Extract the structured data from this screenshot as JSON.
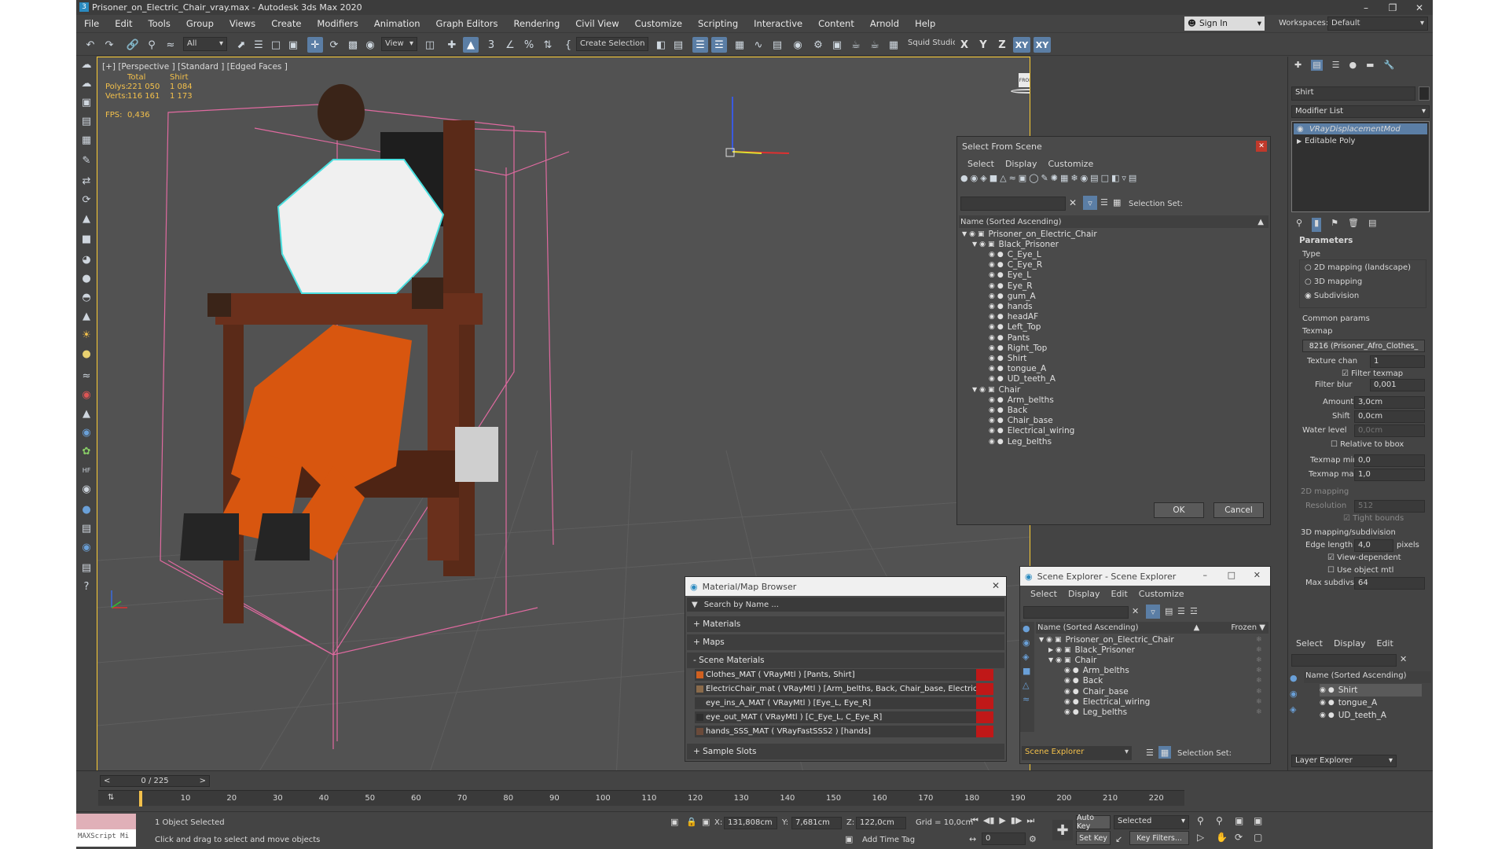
{
  "window": {
    "title": "Prisoner_on_Electric_Chair_vray.max - Autodesk 3ds Max 2020",
    "min": "–",
    "max": "❐",
    "close": "✕"
  },
  "menu": [
    "File",
    "Edit",
    "Tools",
    "Group",
    "Views",
    "Create",
    "Modifiers",
    "Animation",
    "Graph Editors",
    "Rendering",
    "Civil View",
    "Customize",
    "Scripting",
    "Interactive",
    "Content",
    "Arnold",
    "Help"
  ],
  "signin": {
    "label": "Sign In",
    "workspaces_label": "Workspaces:",
    "workspace": "Default"
  },
  "toolbar": {
    "filter_all": "All",
    "view": "View",
    "create_selection": "Create Selection Se",
    "squid": "Squid Studio v",
    "axes": [
      "X",
      "Y",
      "Z",
      "XY",
      "XY"
    ]
  },
  "viewport": {
    "label": "[+] [Perspective ] [Standard ] [Edged Faces ]",
    "stats": {
      "h_total": "Total",
      "h_obj": "Shirt",
      "polys_label": "Polys:",
      "polys_total": "221 050",
      "polys_obj": "1 084",
      "verts_label": "Verts:",
      "verts_total": "116 161",
      "verts_obj": "1 173",
      "fps_label": "FPS:",
      "fps": "0,436"
    },
    "viewcube_label": "FRONT"
  },
  "select_from_scene": {
    "title": "Select From Scene",
    "menus": [
      "Select",
      "Display",
      "Customize"
    ],
    "selection_set_label": "Selection Set:",
    "column": "Name (Sorted Ascending)",
    "tree": [
      {
        "level": 0,
        "name": "Prisoner_on_Electric_Chair",
        "expand": "▼"
      },
      {
        "level": 1,
        "name": "Black_Prisoner",
        "expand": "▼"
      },
      {
        "level": 2,
        "name": "C_Eye_L"
      },
      {
        "level": 2,
        "name": "C_Eye_R"
      },
      {
        "level": 2,
        "name": "Eye_L"
      },
      {
        "level": 2,
        "name": "Eye_R"
      },
      {
        "level": 2,
        "name": "gum_A"
      },
      {
        "level": 2,
        "name": "hands"
      },
      {
        "level": 2,
        "name": "headAF"
      },
      {
        "level": 2,
        "name": "Left_Top"
      },
      {
        "level": 2,
        "name": "Pants"
      },
      {
        "level": 2,
        "name": "Right_Top"
      },
      {
        "level": 2,
        "name": "Shirt"
      },
      {
        "level": 2,
        "name": "tongue_A"
      },
      {
        "level": 2,
        "name": "UD_teeth_A"
      },
      {
        "level": 1,
        "name": "Chair",
        "expand": "▼"
      },
      {
        "level": 2,
        "name": "Arm_belths"
      },
      {
        "level": 2,
        "name": "Back"
      },
      {
        "level": 2,
        "name": "Chair_base"
      },
      {
        "level": 2,
        "name": "Electrical_wiring"
      },
      {
        "level": 2,
        "name": "Leg_belths"
      }
    ],
    "ok": "OK",
    "cancel": "Cancel"
  },
  "material_browser": {
    "title": "Material/Map Browser",
    "search_placeholder": "Search by Name ...",
    "sections": [
      "+ Materials",
      "+ Maps",
      "- Scene Materials"
    ],
    "materials": [
      {
        "name": "Clothes_MAT  ( VRayMtl ) [Pants, Shirt]",
        "color": "#d06020"
      },
      {
        "name": "ElectricChair_mat  ( VRayMtl ) [Arm_belths, Back, Chair_base, Electrical_wiri...",
        "color": "#8a6a4a"
      },
      {
        "name": "eye_ins_A_MAT  ( VRayMtl ) [Eye_L, Eye_R]",
        "color": "#3a3a3a"
      },
      {
        "name": "eye_out_MAT  ( VRayMtl ) [C_Eye_L, C_Eye_R]",
        "color": "#2e2e2e"
      },
      {
        "name": "hands_SSS_MAT  ( VRayFastSSS2 ) [hands]",
        "color": "#6a4a3a"
      }
    ],
    "sample_slots": "+ Sample Slots"
  },
  "scene_explorer": {
    "title": "Scene Explorer - Scene Explorer",
    "menus": [
      "Select",
      "Display",
      "Edit",
      "Customize"
    ],
    "column": "Name (Sorted Ascending)",
    "frozen": "Frozen ▼",
    "tree": [
      {
        "level": 0,
        "name": "Prisoner_on_Electric_Chair",
        "expand": "▼"
      },
      {
        "level": 1,
        "name": "Black_Prisoner",
        "expand": "▶"
      },
      {
        "level": 1,
        "name": "Chair",
        "expand": "▼"
      },
      {
        "level": 2,
        "name": "Arm_belths"
      },
      {
        "level": 2,
        "name": "Back"
      },
      {
        "level": 2,
        "name": "Chair_base"
      },
      {
        "level": 2,
        "name": "Electrical_wiring"
      },
      {
        "level": 2,
        "name": "Leg_belths"
      }
    ],
    "footer_name": "Scene Explorer",
    "selection_set_label": "Selection Set:"
  },
  "command_panel": {
    "object_name": "Shirt",
    "modifier_list": "Modifier List",
    "stack": [
      "VRayDisplacementMod",
      "Editable Poly"
    ],
    "parameters": "Parameters",
    "type_label": "Type",
    "types": [
      "2D mapping (landscape)",
      "3D mapping",
      "Subdivision"
    ],
    "common_params": "Common params",
    "texmap_label": "Texmap",
    "texmap": "8216 (Prisoner_Afro_Clothes_",
    "texture_chan_label": "Texture chan",
    "texture_chan": "1",
    "filter_texmap": "Filter texmap",
    "filter_blur_label": "Filter blur",
    "filter_blur": "0,001",
    "amount_label": "Amount",
    "amount": "3,0cm",
    "shift_label": "Shift",
    "shift": "0,0cm",
    "water_label": "Water level",
    "water": "0,0cm",
    "relative_bbox": "Relative to bbox",
    "texmap_min_label": "Texmap min",
    "texmap_min": "0,0",
    "texmap_max_label": "Texmap max",
    "texmap_max": "1,0",
    "mapping2d": "2D mapping",
    "resolution_label": "Resolution",
    "resolution": "512",
    "tight_bounds": "Tight bounds",
    "mapping3d": "3D mapping/subdivision",
    "edge_length_label": "Edge length",
    "edge_length": "4,0",
    "pixels": "pixels",
    "view_dependent": "View-dependent",
    "use_object_mtl": "Use object mtl",
    "max_subdivs_label": "Max subdivs",
    "max_subdivs": "64"
  },
  "layer_explorer": {
    "menus": [
      "Select",
      "Display",
      "Edit"
    ],
    "column": "Name (Sorted Ascending)",
    "items": [
      "Shirt",
      "tongue_A",
      "UD_teeth_A"
    ],
    "footer": "Layer Explorer"
  },
  "timeline": {
    "frame": "0 / 225",
    "ticks": [
      "10",
      "20",
      "30",
      "40",
      "50",
      "60",
      "70",
      "80",
      "90",
      "100",
      "110",
      "120",
      "130",
      "140",
      "150",
      "160",
      "170",
      "180",
      "190",
      "200",
      "210",
      "220"
    ]
  },
  "status": {
    "maxscript": "MAXScript Mi",
    "selected": "1 Object Selected",
    "hint": "Click and drag to select and move objects",
    "x_label": "X:",
    "x": "131,808cm",
    "y_label": "Y:",
    "y": "7,681cm",
    "z_label": "Z:",
    "z": "122,0cm",
    "grid": "Grid = 10,0cm",
    "add_time_tag": "Add Time Tag",
    "auto_key": "Auto Key",
    "set_key": "Set Key",
    "selected_combo": "Selected",
    "key_filters": "Key Filters...",
    "frame_field": "0"
  }
}
